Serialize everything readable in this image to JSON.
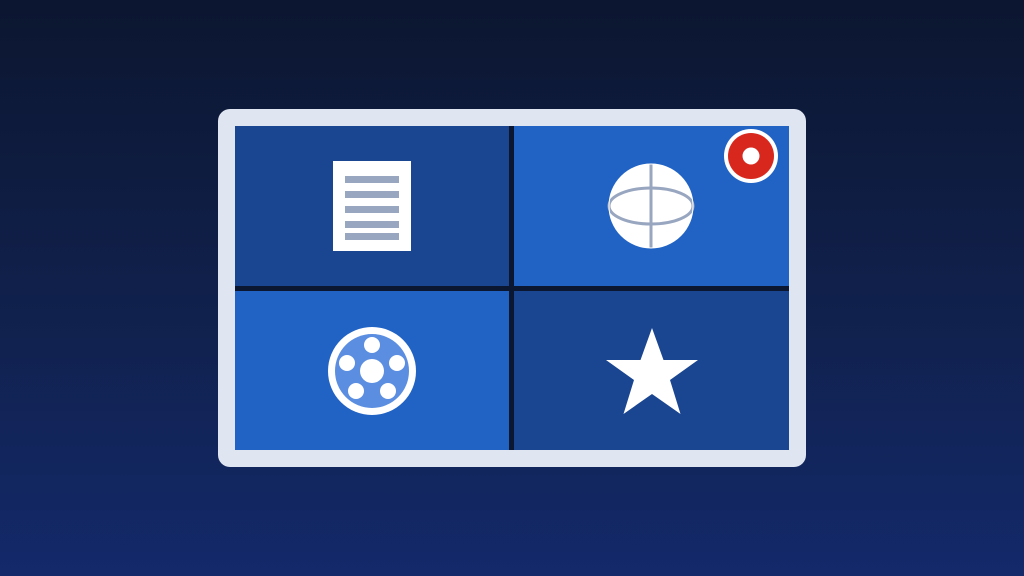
{
  "colors": {
    "background_top": "#0c1630",
    "background_bottom": "#13296a",
    "frame": "#dfe6f1",
    "tile_dark": "#1a4590",
    "tile_light": "#2163c4",
    "badge": "#d8281e",
    "icon_white": "#ffffff",
    "icon_grey": "#98a6c0",
    "film_blue": "#5b8ee0"
  },
  "tiles": [
    {
      "id": "documents",
      "icon": "document-icon",
      "color": "#1a4590"
    },
    {
      "id": "globe",
      "icon": "globe-icon",
      "color": "#2163c4",
      "badge": "record-badge-icon"
    },
    {
      "id": "media",
      "icon": "film-reel-icon",
      "color": "#2163c4"
    },
    {
      "id": "favorites",
      "icon": "star-icon",
      "color": "#1a4590"
    }
  ]
}
